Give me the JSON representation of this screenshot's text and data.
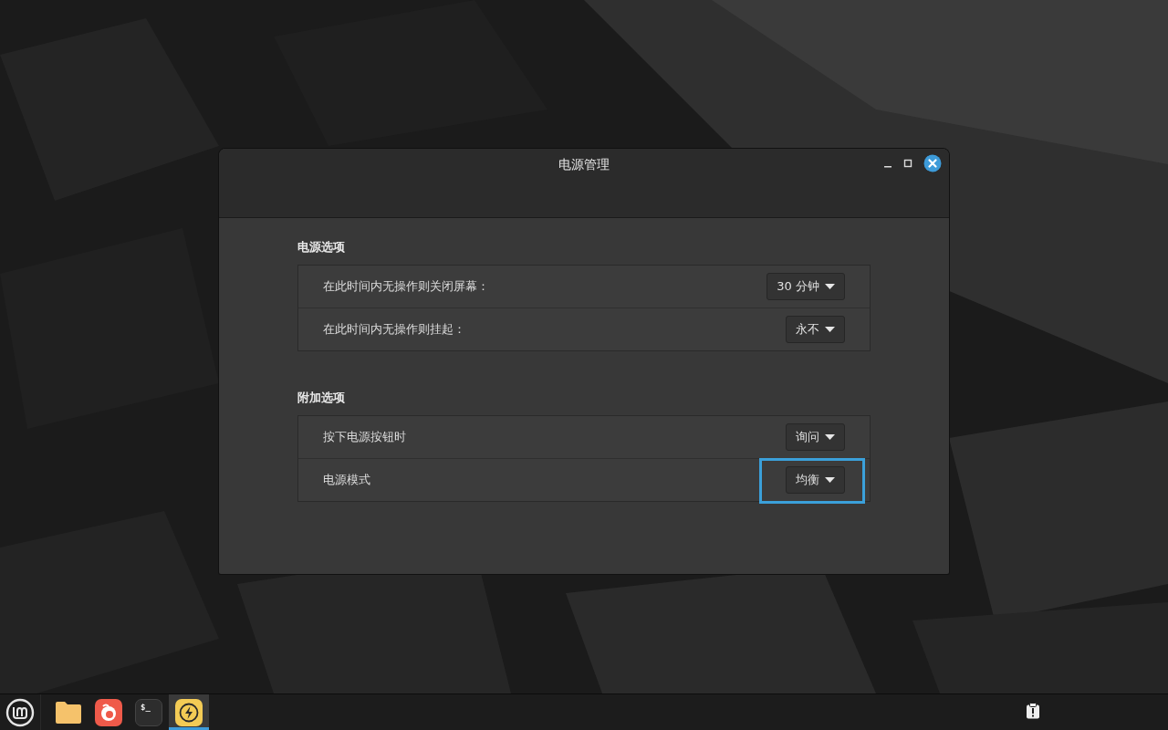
{
  "window": {
    "title": "电源管理"
  },
  "sections": [
    {
      "title": "电源选项",
      "rows": [
        {
          "label": "在此时间内无操作则关闭屏幕：",
          "value": "30 分钟",
          "highlighted": false
        },
        {
          "label": "在此时间内无操作则挂起：",
          "value": "永不",
          "highlighted": false
        }
      ]
    },
    {
      "title": "附加选项",
      "rows": [
        {
          "label": "按下电源按钮时",
          "value": "询问",
          "highlighted": false
        },
        {
          "label": "电源模式",
          "value": "均衡",
          "highlighted": true
        }
      ]
    }
  ],
  "taskbar": {
    "apps": [
      {
        "kind": "files",
        "selected": false
      },
      {
        "kind": "browser",
        "selected": false
      },
      {
        "kind": "terminal",
        "glyph": "$_",
        "selected": false
      },
      {
        "kind": "power",
        "selected": true
      }
    ]
  }
}
